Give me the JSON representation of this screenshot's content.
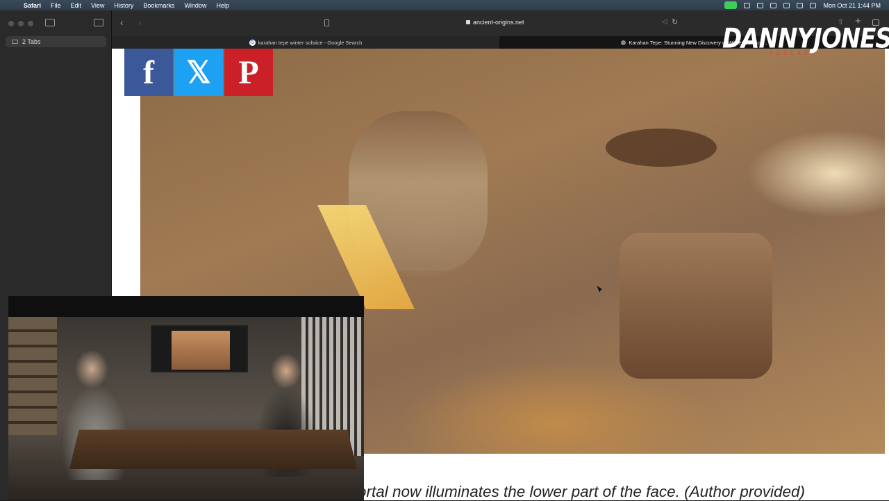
{
  "menubar": {
    "app": "Safari",
    "items": [
      "File",
      "Edit",
      "View",
      "History",
      "Bookmarks",
      "Window",
      "Help"
    ],
    "datetime": "Mon Oct 21  1:44 PM"
  },
  "sidebar": {
    "tabs_label": "2 Tabs"
  },
  "toolbar": {
    "url": "ancient-origins.net"
  },
  "tabs": [
    {
      "title": "karahan tepe winter solstice - Google Search",
      "favicon": "G"
    },
    {
      "title": "Karahan Tepe: Stunning New Discovery of Winter Solstice..."
    }
  ],
  "social": {
    "facebook": "f",
    "x": "𝕏",
    "pinterest": "P"
  },
  "caption": "The light coming through the portal now illuminates the lower part of the face. (Author provided)",
  "logo": {
    "name": "DANNYJONES",
    "sub": "PODCAST"
  }
}
